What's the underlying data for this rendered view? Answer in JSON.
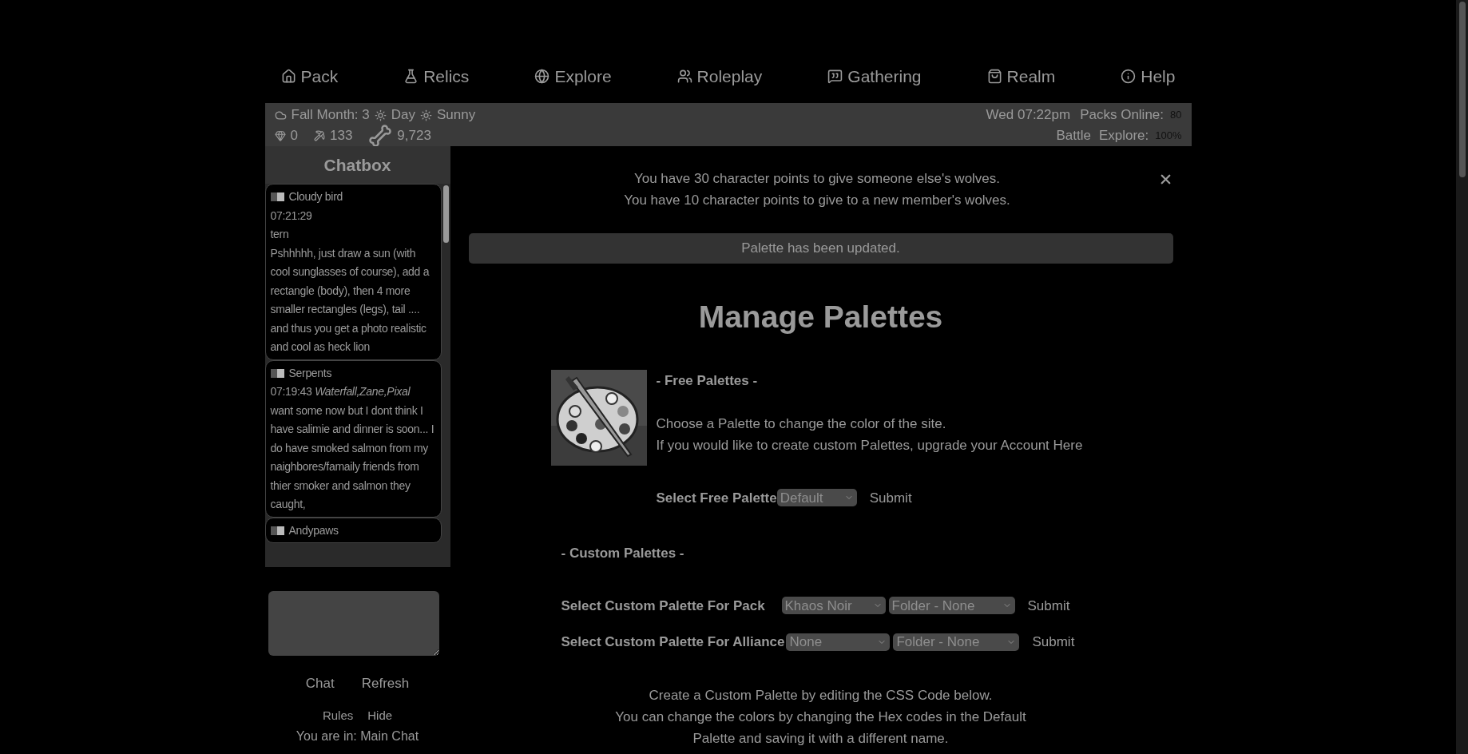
{
  "nav": [
    {
      "label": "Pack"
    },
    {
      "label": "Relics"
    },
    {
      "label": "Explore"
    },
    {
      "label": "Roleplay"
    },
    {
      "label": "Gathering"
    },
    {
      "label": "Realm"
    },
    {
      "label": "Help"
    }
  ],
  "status": {
    "season": "Fall Month: 3",
    "time_of_day": "Day",
    "weather": "Sunny",
    "stats": [
      "0",
      "133",
      "9,723"
    ],
    "datetime": "Wed 07:22pm",
    "packs_online_label": "Packs Online:",
    "packs_online": "80",
    "battle": "Battle",
    "explore_label": "Explore:",
    "explore": "100%"
  },
  "chat": {
    "title": "Chatbox",
    "messages": [
      {
        "user": "Cloudy bird",
        "time": "07:21:29",
        "lines": [
          "tern",
          "Pshhhhh, just draw a sun (with cool sunglasses of course), add a rectangle (body), then 4 more smaller rectangles (legs), tail .... and thus you get a photo realistic and cool as heck lion"
        ]
      },
      {
        "user": "Serpents",
        "time": "07:19:43",
        "recipients": "Waterfall,Zane,Pixal",
        "lines": [
          "want some now but I dont think I have salimie and dinner is soon... I do have smoked salmon from my naighbores/famaily friends from thier smoker and salmon they caught,"
        ]
      },
      {
        "user": "Andypaws"
      }
    ],
    "buttons": [
      "Chat",
      "Refresh"
    ],
    "links": [
      "Rules",
      "Hide"
    ],
    "location": "You are in: Main Chat"
  },
  "notices": [
    "You have 30 character points to give someone else's wolves.",
    "You have 10 character points to give to a new member's wolves."
  ],
  "banner": "Palette has been updated.",
  "title": "Manage Palettes",
  "free": {
    "heading": "- Free Palettes -",
    "lines": [
      "Choose a Palette to change the color of the site.",
      "If you would like to create custom Palettes, upgrade your Account Here"
    ],
    "label": "Select Free Palette",
    "value": "Default",
    "submit": "Submit"
  },
  "custom": {
    "heading": "- Custom Palettes -",
    "rows": [
      {
        "label": "Select Custom Palette For Pack",
        "palette": "Khaos Noir",
        "folder": "Folder - None",
        "submit": "Submit"
      },
      {
        "label": "Select Custom Palette For Alliance",
        "palette": "None",
        "folder": "Folder - None",
        "submit": "Submit"
      }
    ]
  },
  "footer": [
    "Create a Custom Palette by editing the CSS Code below.",
    "You can change the colors by changing the Hex codes in the Default",
    "Palette and saving it with a different name."
  ]
}
